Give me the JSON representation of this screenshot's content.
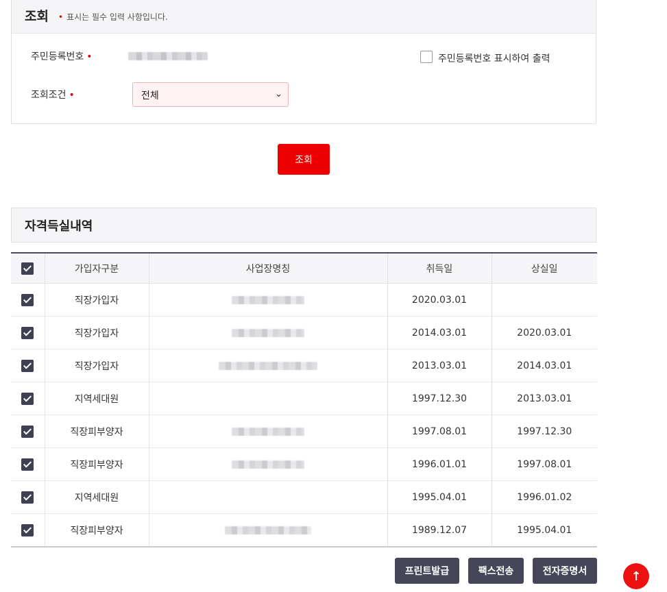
{
  "query_panel": {
    "title": "조회",
    "required_dot": "•",
    "required_note": "표시는 필수 입력 사항입니다.",
    "rrn_label": "주민등록번호",
    "print_rrn_label": "주민등록번호 표시하여 출력",
    "condition_label": "조회조건",
    "condition_value": "전체",
    "search_button": "조회"
  },
  "history_panel": {
    "title": "자격득실내역",
    "columns": [
      "가입자구분",
      "사업장명칭",
      "취득일",
      "상실일"
    ],
    "rows": [
      {
        "type": "직장가입자",
        "acquired": "2020.03.01",
        "lost": ""
      },
      {
        "type": "직장가입자",
        "acquired": "2014.03.01",
        "lost": "2020.03.01"
      },
      {
        "type": "직장가입자",
        "acquired": "2013.03.01",
        "lost": "2014.03.01"
      },
      {
        "type": "지역세대원",
        "acquired": "1997.12.30",
        "lost": "2013.03.01"
      },
      {
        "type": "직장피부양자",
        "acquired": "1997.08.01",
        "lost": "1997.12.30"
      },
      {
        "type": "직장피부양자",
        "acquired": "1996.01.01",
        "lost": "1997.08.01"
      },
      {
        "type": "지역세대원",
        "acquired": "1995.04.01",
        "lost": "1996.01.02"
      },
      {
        "type": "직장피부양자",
        "acquired": "1989.12.07",
        "lost": "1995.04.01"
      }
    ]
  },
  "actions": {
    "print_button": "프린트발급",
    "fax_button": "팩스전송",
    "ecert_button": "전자증명서"
  },
  "colors": {
    "accent": "#ee0000",
    "dark_button": "#454759"
  }
}
